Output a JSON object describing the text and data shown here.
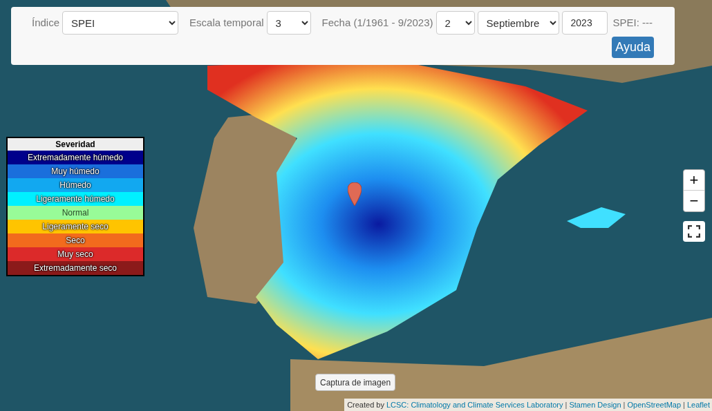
{
  "controls": {
    "index": {
      "label": "Índice",
      "value": "SPEI"
    },
    "scale": {
      "label": "Escala temporal",
      "value": "3"
    },
    "date": {
      "label": "Fecha (1/1961 - 9/2023)",
      "day": "2",
      "month": "Septiembre",
      "year": "2023"
    },
    "reading": "SPEI: ---",
    "help_button": "Ayuda"
  },
  "legend": {
    "title": "Severidad",
    "items": [
      {
        "label": "Extremadamente húmedo",
        "color": "#00008b"
      },
      {
        "label": "Muy húmedo",
        "color": "#1a6fdc"
      },
      {
        "label": "Húmedo",
        "color": "#12a8f0"
      },
      {
        "label": "Ligeramente húmedo",
        "color": "#00f0ff"
      },
      {
        "label": "Normal",
        "color": "#98fb98"
      },
      {
        "label": "Ligeramente seco",
        "color": "#ffc400"
      },
      {
        "label": "Seco",
        "color": "#f26b1d"
      },
      {
        "label": "Muy seco",
        "color": "#dc2a2a"
      },
      {
        "label": "Extremadamente seco",
        "color": "#8b1a1a"
      }
    ]
  },
  "zoom": {
    "in": "+",
    "out": "−"
  },
  "capture_button": "Captura de imagen",
  "attribution": {
    "prefix": "Created by",
    "separator": "|",
    "links": [
      "LCSC: Climatology and Climate Services Laboratory",
      "Stamen Design",
      "OpenStreetMap",
      "Leaflet"
    ]
  }
}
